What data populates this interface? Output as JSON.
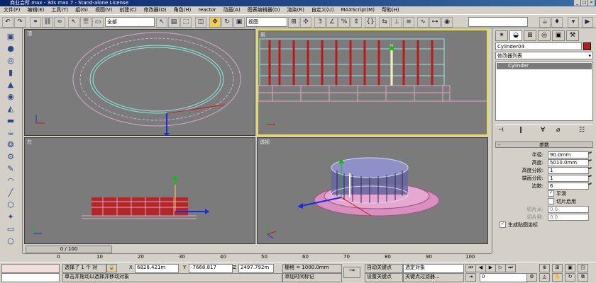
{
  "window": {
    "title": "商业会所.max - 3ds max 7 - Stand-alone License"
  },
  "menu": [
    "文件(F)",
    "编辑(E)",
    "工具(T)",
    "组(G)",
    "视图(V)",
    "创建(C)",
    "修改器(O)",
    "角色(H)",
    "reactor",
    "动画(A)",
    "图表编辑器(D)",
    "渲染(R)",
    "自定义(U)",
    "MAXScript(M)",
    "帮助(H)"
  ],
  "toolbar": {
    "selection_filter": "全部",
    "ref_coord": "视图",
    "named_selection": ""
  },
  "viewports": {
    "top": "顶",
    "front": "前",
    "left": "左",
    "perspective": "透视"
  },
  "command_panel": {
    "object_name": "Cylinder04",
    "object_color": "#c01818",
    "modifier_list": "修改器列表",
    "stack_item": "Cylinder",
    "rollout_title": "参数",
    "params": [
      {
        "label": "半径:",
        "value": "90.0mm"
      },
      {
        "label": "高度:",
        "value": "5010.0mm"
      },
      {
        "label": "高度分段:",
        "value": "1"
      },
      {
        "label": "端面分段:",
        "value": "1"
      },
      {
        "label": "边数:",
        "value": "6"
      }
    ],
    "smooth": {
      "label": "平滑",
      "checked": true
    },
    "slice_on": {
      "label": "切片启用",
      "checked": false
    },
    "slice_from": {
      "label": "切片从:",
      "value": "0.0"
    },
    "slice_to": {
      "label": "切片到:",
      "value": "0.0"
    },
    "gen_uv": {
      "label": "生成贴图坐标",
      "checked": true
    }
  },
  "timeline": {
    "slider": "0 / 100",
    "ticks": [
      "0",
      "10",
      "20",
      "30",
      "40",
      "50",
      "60",
      "70",
      "80",
      "90",
      "100"
    ]
  },
  "status": {
    "selection": "选择了 1 个 对",
    "x_label": "X",
    "x_value": "6828.421m",
    "y_label": "Y",
    "y_value": "-7668.817",
    "z_label": "Z",
    "z_value": "2497.792m",
    "grid": "栅格 = 1000.0mm",
    "auto_key": "自动关键点",
    "key_mode": "选定对象",
    "set_key": "设置关键点",
    "key_filters": "关键点过滤器...",
    "frame": "0",
    "prompt": "单击并拖动以选择并移动对象",
    "add_time_tag": "添加时间标记"
  }
}
